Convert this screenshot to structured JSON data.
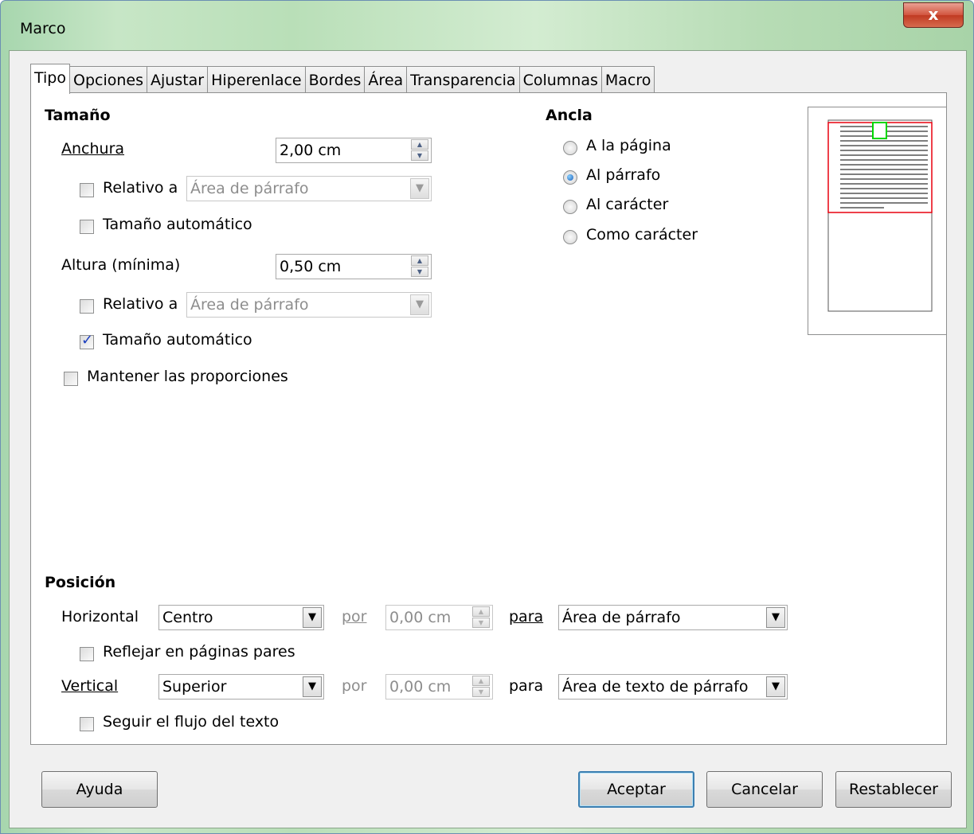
{
  "window": {
    "title": "Marco",
    "close_label": "x"
  },
  "tabs": [
    {
      "label": "Tipo",
      "active": true
    },
    {
      "label": "Opciones"
    },
    {
      "label": "Ajustar"
    },
    {
      "label": "Hiperenlace"
    },
    {
      "label": "Bordes"
    },
    {
      "label": "Área"
    },
    {
      "label": "Transparencia"
    },
    {
      "label": "Columnas"
    },
    {
      "label": "Macro"
    }
  ],
  "size": {
    "heading": "Tamaño",
    "width_label": "Anchura",
    "width_value": "2,00 cm",
    "width_relative": {
      "label": "Relativo a",
      "checked": false,
      "combo_value": "Área de párrafo"
    },
    "width_auto": {
      "label": "Tamaño automático",
      "checked": false
    },
    "height_label": "Altura (mínima)",
    "height_value": "0,50 cm",
    "height_relative": {
      "label": "Relativo a",
      "checked": false,
      "combo_value": "Área de párrafo"
    },
    "height_auto": {
      "label": "Tamaño automático",
      "checked": true
    },
    "keep_ratio": {
      "label": "Mantener las proporciones",
      "checked": false
    }
  },
  "anchor": {
    "heading": "Ancla",
    "options": [
      {
        "label": "A la página",
        "checked": false
      },
      {
        "label": "Al párrafo",
        "checked": true
      },
      {
        "label": "Al carácter",
        "checked": false
      },
      {
        "label": "Como carácter",
        "checked": false
      }
    ]
  },
  "position": {
    "heading": "Posición",
    "horizontal_label": "Horizontal",
    "horizontal_value": "Centro",
    "horizontal_by_label": "por",
    "horizontal_by_value": "0,00 cm",
    "horizontal_to_label": "para",
    "horizontal_to_value": "Área de párrafo",
    "mirror": {
      "label": "Reflejar en páginas pares",
      "checked": false
    },
    "vertical_label": "Vertical",
    "vertical_value": "Superior",
    "vertical_by_label": "por",
    "vertical_by_value": "0,00 cm",
    "vertical_to_label": "para",
    "vertical_to_value": "Área de texto de párrafo",
    "follow_flow": {
      "label": "Seguir el flujo del texto",
      "checked": false
    }
  },
  "buttons": {
    "help": "Ayuda",
    "ok": "Aceptar",
    "cancel": "Cancelar",
    "reset": "Restablecer"
  },
  "colors": {
    "preview_paragraph": "#e8000f",
    "preview_frame": "#00d700",
    "preview_text": "#7f7f7f"
  }
}
